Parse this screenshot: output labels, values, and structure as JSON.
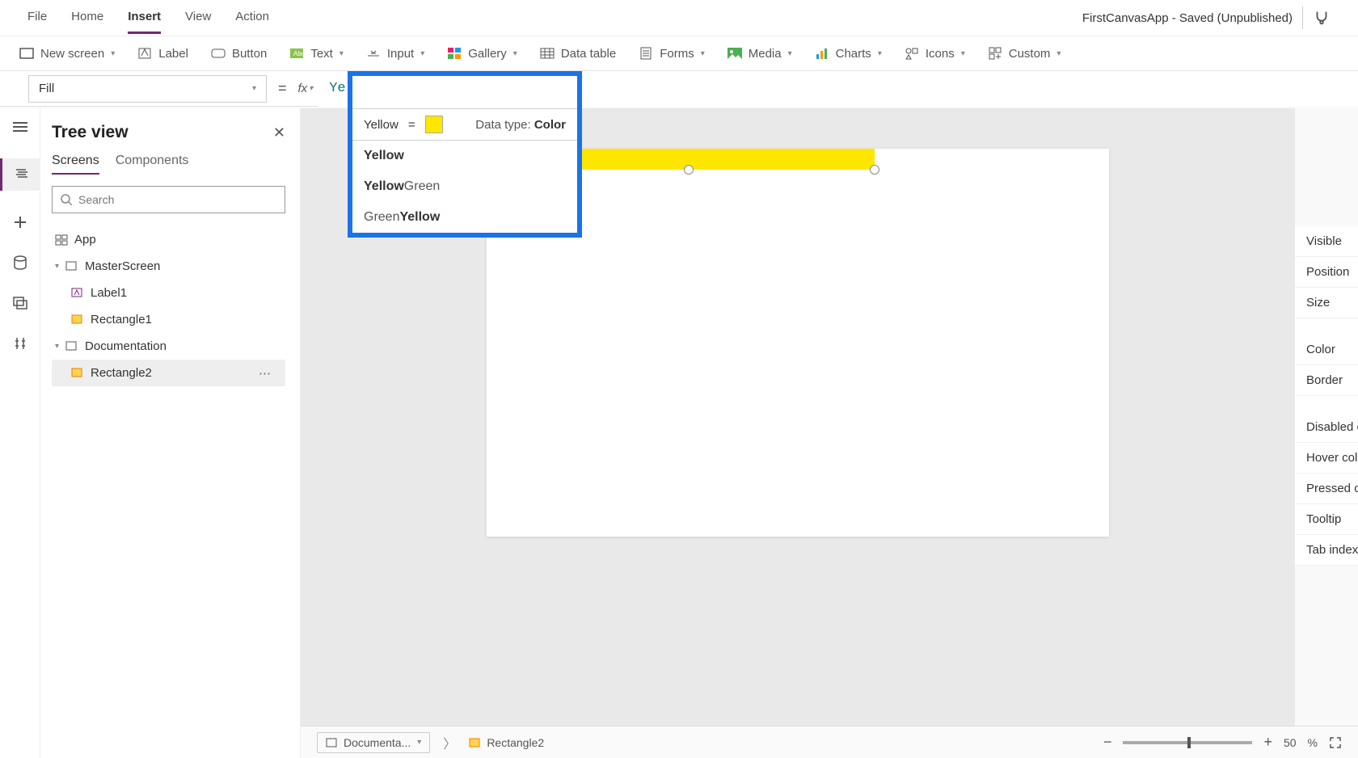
{
  "app_title": "FirstCanvasApp - Saved (Unpublished)",
  "menu": {
    "file": "File",
    "home": "Home",
    "insert": "Insert",
    "view": "View",
    "action": "Action"
  },
  "ribbon": {
    "new_screen": "New screen",
    "label": "Label",
    "button": "Button",
    "text": "Text",
    "input": "Input",
    "gallery": "Gallery",
    "data_table": "Data table",
    "forms": "Forms",
    "media": "Media",
    "charts": "Charts",
    "icons": "Icons",
    "custom": "Custom"
  },
  "formula": {
    "property": "Fill",
    "value": "Yellow",
    "fx": "fx",
    "equals": "="
  },
  "popup": {
    "eval_name": "Yellow",
    "eval_eq": "=",
    "datatype_label": "Data type: ",
    "datatype_value": "Color",
    "suggestions": [
      {
        "pre": "",
        "match": "Yellow",
        "post": ""
      },
      {
        "pre": "",
        "match": "Yellow",
        "post": "Green"
      },
      {
        "pre": "Green",
        "match": "Yellow",
        "post": ""
      }
    ]
  },
  "tree": {
    "title": "Tree view",
    "tabs": {
      "screens": "Screens",
      "components": "Components"
    },
    "search_placeholder": "Search",
    "nodes": {
      "app": "App",
      "master": "MasterScreen",
      "label1": "Label1",
      "rect1": "Rectangle1",
      "doc": "Documentation",
      "rect2": "Rectangle2"
    }
  },
  "props": {
    "visible": "Visible",
    "position": "Position",
    "size": "Size",
    "color": "Color",
    "border": "Border",
    "disabled": "Disabled color",
    "hover": "Hover color",
    "pressed": "Pressed color",
    "tooltip": "Tooltip",
    "tabindex": "Tab index"
  },
  "bottom": {
    "crumb1": "Documenta...",
    "crumb2": "Rectangle2",
    "zoom_value": "50",
    "zoom_unit": "%"
  }
}
